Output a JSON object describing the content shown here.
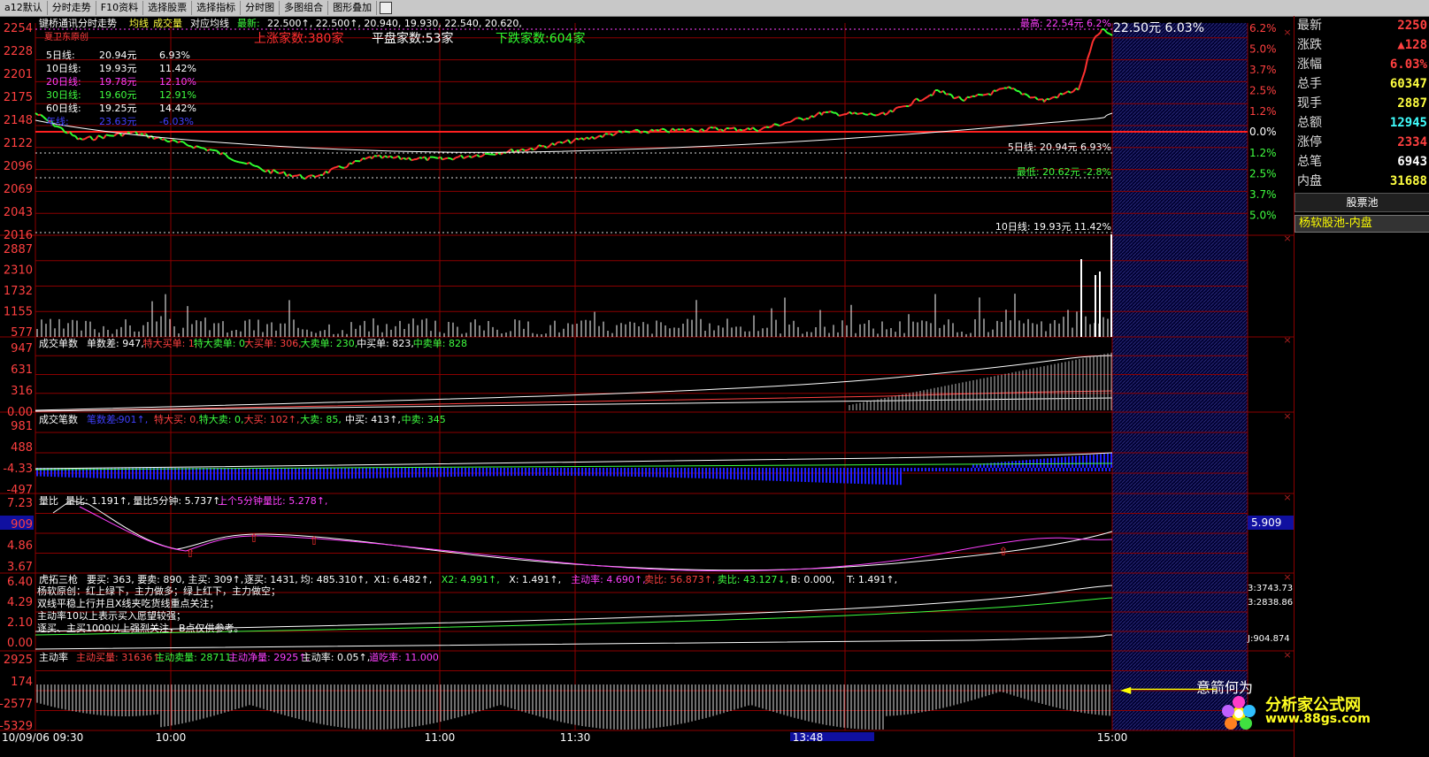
{
  "toolbar": {
    "items": [
      "a12默认",
      "分时走势",
      "F10资料",
      "选择股票",
      "选择指标",
      "分时图",
      "多图组合",
      "图形叠加"
    ]
  },
  "header": {
    "stock_name": "键桥通讯分时走势",
    "avg_label": "均线",
    "vol_label": "成交量",
    "ref_avg": "对应均线",
    "latest_label": "最新:",
    "latest_values": "22.500↑, 22.500↑, 20.940, 19.930, 22.540, 20.620,"
  },
  "main_panel": {
    "author_tag": "夏卫东原创",
    "up_count": "上涨家数:380家",
    "flat_count": "平盘家数:53家",
    "down_count": "下跌家数:604家",
    "price_label": "22.50元  6.03%",
    "high_label": "最高: 22.54元  6.2%",
    "low_label": "最低: 20.62元  -2.8%",
    "ma5_note": "5日线: 20.94元  6.93%",
    "ma10_note": "10日线: 19.93元  11.42%",
    "ma_table": [
      {
        "name": "5日线:",
        "price": "20.94元",
        "pct": "6.93%",
        "color": "#ffffff"
      },
      {
        "name": "10日线:",
        "price": "19.93元",
        "pct": "11.42%",
        "color": "#ffffff"
      },
      {
        "name": "20日线:",
        "price": "19.78元",
        "pct": "12.10%",
        "color": "#ff40ff"
      },
      {
        "name": "30日线:",
        "price": "19.60元",
        "pct": "12.91%",
        "color": "#40ff40"
      },
      {
        "name": "60日线:",
        "price": "19.25元",
        "pct": "14.42%",
        "color": "#ffffff"
      },
      {
        "name": "年线:",
        "price": "23.63元",
        "pct": "-6.03%",
        "color": "#4040ff"
      }
    ],
    "y_ticks": [
      "2254",
      "2228",
      "2201",
      "2175",
      "2148",
      "2122",
      "2096",
      "2069",
      "2043",
      "2016"
    ],
    "pct_ticks_up": [
      "6.2%",
      "5.0%",
      "3.7%",
      "2.5%",
      "1.2%"
    ],
    "pct_zero": "0.0%",
    "pct_ticks_down": [
      "1.2%",
      "2.5%",
      "3.7%",
      "5.0%"
    ]
  },
  "vol_panel": {
    "y_ticks": [
      "2887",
      "2310",
      "1732",
      "1155",
      "577"
    ]
  },
  "order_panel": {
    "title": "成交单数",
    "items": [
      {
        "text": "单数差: 947,",
        "color": "#ffffff"
      },
      {
        "text": "特大买单: 1,",
        "color": "#ff4040"
      },
      {
        "text": "特大卖单: 0,",
        "color": "#40ff40"
      },
      {
        "text": "大买单: 306,",
        "color": "#ff4040"
      },
      {
        "text": "大卖单: 230,",
        "color": "#40ff40"
      },
      {
        "text": "中买单: 823,",
        "color": "#ffffff"
      },
      {
        "text": "中卖单: 828",
        "color": "#40ff40"
      }
    ],
    "y_ticks": [
      "947",
      "631",
      "316",
      "0.00"
    ]
  },
  "trades_panel": {
    "title": "成交笔数",
    "items": [
      {
        "text": "笔数差:",
        "color": "#4040ff"
      },
      {
        "text": "-901↑,",
        "color": "#4040ff"
      },
      {
        "text": "特大买: 0,",
        "color": "#ff4040"
      },
      {
        "text": "特大卖: 0,",
        "color": "#40ff40"
      },
      {
        "text": "大买: 102↑,",
        "color": "#ff4040"
      },
      {
        "text": "大卖: 85,",
        "color": "#40ff40"
      },
      {
        "text": "中买: 413↑,",
        "color": "#ffffff"
      },
      {
        "text": "中卖: 345",
        "color": "#40ff40"
      }
    ],
    "y_ticks": [
      "981",
      "488",
      "-4.33",
      "-497"
    ]
  },
  "ratio_panel": {
    "title": "量比",
    "items": [
      {
        "text": "量比: 1.191↑,",
        "color": "#ffffff"
      },
      {
        "text": "量比5分钟: 5.737↑,",
        "color": "#ffffff"
      },
      {
        "text": "上个5分钟量比: 5.278↑,",
        "color": "#ff40ff"
      }
    ],
    "y_ticks": [
      "7.23",
      "909",
      "4.86",
      "3.67"
    ],
    "right_value": "5.909"
  },
  "tiger_panel": {
    "title": "虎拓三枪",
    "items": [
      {
        "text": "要买: 363,",
        "color": "#ffffff"
      },
      {
        "text": "要卖: 890,",
        "color": "#ffffff"
      },
      {
        "text": "主买: 309↑,",
        "color": "#ffffff"
      },
      {
        "text": "逐买: 1431,",
        "color": "#ffffff"
      },
      {
        "text": "均: 485.310↑,",
        "color": "#ffffff"
      },
      {
        "text": "X1: 6.482↑,",
        "color": "#ffffff"
      },
      {
        "text": "X2: 4.991↑,",
        "color": "#40ff40"
      },
      {
        "text": "X: 1.491↑,",
        "color": "#ffffff"
      },
      {
        "text": "主动率: 4.690↑,",
        "color": "#ff40ff"
      },
      {
        "text": "卖比: 56.873↑,",
        "color": "#ff4040"
      },
      {
        "text": "卖比: 43.127↓,",
        "color": "#40ff40"
      },
      {
        "text": "B: 0.000,",
        "color": "#ffffff"
      },
      {
        "text": "T: 1.491↑,",
        "color": "#ffffff"
      }
    ],
    "notes": [
      "杨软原创：红上绿下，主力做多；绿上红下，主力做空；",
      "双线平稳上行并且X线夹吃货线重点关注；",
      "主动率10以上表示买入愿望较强；",
      "逐买、主买1000以上强烈关注，B点仅供参考。"
    ],
    "y_ticks": [
      "6.40",
      "4.29",
      "2.10",
      "0.00"
    ],
    "right_labels": [
      "3:3743.73",
      "3:2838.86",
      "J:904.874"
    ]
  },
  "active_panel": {
    "title": "主动率",
    "items": [
      {
        "text": "主动买量: 31636↑,",
        "color": "#ff4040"
      },
      {
        "text": "主动卖量: 28711,",
        "color": "#40ff40"
      },
      {
        "text": "主动净量: 2925↑,",
        "color": "#ff40ff"
      },
      {
        "text": "主动率: 0.05↑,",
        "color": "#ffffff"
      },
      {
        "text": "道吃率: 11.000",
        "color": "#ff40ff"
      }
    ],
    "y_ticks": [
      "2925",
      "174",
      "-2577",
      "-5329"
    ],
    "note": "意箭何为"
  },
  "x_axis": {
    "labels": [
      "10/09/06 09:30",
      "10:00",
      "11:00",
      "11:30",
      "13:48",
      "15:00"
    ]
  },
  "quote": {
    "rows": [
      {
        "label": "最新",
        "value": "2250",
        "color": "#ff4040"
      },
      {
        "label": "涨跌",
        "value": "▲128",
        "color": "#ff4040"
      },
      {
        "label": "涨幅",
        "value": "6.03%",
        "color": "#ff4040"
      },
      {
        "label": "总手",
        "value": "60347",
        "color": "#ffff40"
      },
      {
        "label": "现手",
        "value": "2887",
        "color": "#ffff40"
      },
      {
        "label": "总额",
        "value": "12945",
        "color": "#40ffff"
      },
      {
        "label": "涨停",
        "value": "2334",
        "color": "#ff4040"
      },
      {
        "label": "总笔",
        "value": "6943",
        "color": "#ffffff"
      },
      {
        "label": "内盘",
        "value": "31688",
        "color": "#ffff40"
      }
    ],
    "pool_button": "股票池",
    "pool_tab": "杨软股池-内盘"
  },
  "logo": {
    "text": "分析家公式网",
    "url": "www.88gs.com"
  },
  "colors": {
    "up": "#ff3030",
    "down": "#30ff30",
    "grid": "#8b0000",
    "bg": "#000000"
  }
}
